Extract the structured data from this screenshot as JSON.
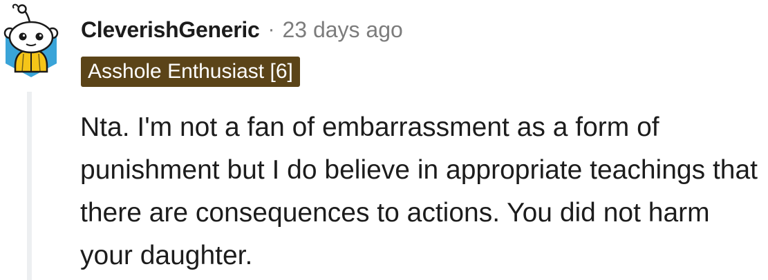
{
  "comment": {
    "author": "CleverishGeneric",
    "separator": "·",
    "timestamp": "23 days ago",
    "flair": "Asshole Enthusiast [6]",
    "body": "Nta. I'm not a fan of embarrassment as a form of punishment but I do believe in appropriate teachings that there are consequences to actions. You did not harm your daughter.",
    "avatar_icon": "snoo-avatar-icon",
    "colors": {
      "flair_background": "#5b4418",
      "flair_text": "#ffffff",
      "meta_text": "#7c7c7c",
      "thread_line": "#edeff1",
      "avatar_background": "#3aa4d8"
    }
  }
}
